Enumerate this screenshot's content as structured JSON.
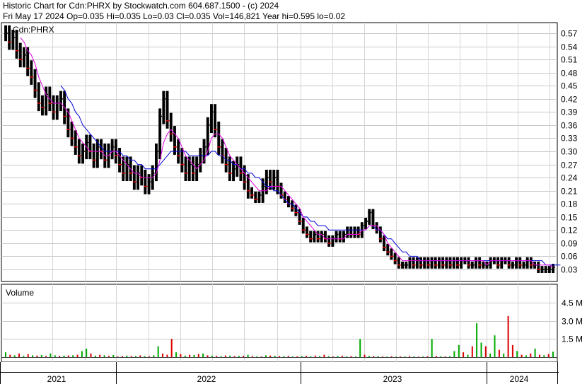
{
  "header": {
    "line1": "Historic Chart for Cdn:PHRX by Stockwatch.com 604.687.1500 - (c) 2024",
    "line2": "Fri May 17 2024   Op=0.035  Hi=0.035   Lo=0.03   Cl=0.035   Vol=146,821   Year hi=0.595   lo=0.02"
  },
  "chart_data": [
    {
      "type": "bar",
      "subtype": "ohlc-price",
      "symbol_label": "Cdn:PHRX",
      "y_axis_side": "right",
      "ylim": [
        0.02,
        0.59
      ],
      "y_ticks": [
        "0.57",
        "0.54",
        "0.51",
        "0.48",
        "0.45",
        "0.42",
        "0.39",
        "0.36",
        "0.33",
        "0.30",
        "0.27",
        "0.24",
        "0.21",
        "0.18",
        "0.15",
        "0.12",
        "0.09",
        "0.06",
        "0.03"
      ],
      "x_ticks": [
        "2021",
        "2022",
        "2023",
        "2024"
      ],
      "grid": true,
      "colors": {
        "bars": "#000000",
        "ma_short": "#e000e0",
        "ma_long": "#0000dd",
        "down_tick": "#dd0000"
      },
      "closes": [
        0.57,
        0.55,
        0.56,
        0.53,
        0.51,
        0.52,
        0.49,
        0.47,
        0.44,
        0.41,
        0.4,
        0.43,
        0.41,
        0.39,
        0.41,
        0.42,
        0.38,
        0.35,
        0.33,
        0.31,
        0.29,
        0.3,
        0.32,
        0.3,
        0.28,
        0.31,
        0.3,
        0.28,
        0.3,
        0.31,
        0.29,
        0.27,
        0.25,
        0.27,
        0.25,
        0.23,
        0.25,
        0.24,
        0.22,
        0.23,
        0.25,
        0.3,
        0.38,
        0.42,
        0.37,
        0.34,
        0.31,
        0.29,
        0.27,
        0.25,
        0.27,
        0.25,
        0.27,
        0.29,
        0.31,
        0.36,
        0.39,
        0.35,
        0.31,
        0.29,
        0.27,
        0.25,
        0.26,
        0.27,
        0.25,
        0.23,
        0.21,
        0.2,
        0.19,
        0.2,
        0.22,
        0.24,
        0.23,
        0.24,
        0.22,
        0.2,
        0.19,
        0.18,
        0.17,
        0.16,
        0.14,
        0.12,
        0.11,
        0.1,
        0.11,
        0.1,
        0.11,
        0.1,
        0.09,
        0.1,
        0.11,
        0.1,
        0.11,
        0.12,
        0.11,
        0.12,
        0.11,
        0.13,
        0.14,
        0.16,
        0.13,
        0.12,
        0.1,
        0.08,
        0.07,
        0.06,
        0.05,
        0.04,
        0.04,
        0.04,
        0.05,
        0.04,
        0.05,
        0.04,
        0.05,
        0.04,
        0.05,
        0.04,
        0.05,
        0.04,
        0.05,
        0.04,
        0.05,
        0.04,
        0.05,
        0.05,
        0.04,
        0.04,
        0.05,
        0.04,
        0.04,
        0.04,
        0.05,
        0.05,
        0.04,
        0.05,
        0.05,
        0.04,
        0.04,
        0.05,
        0.04,
        0.04,
        0.05,
        0.04,
        0.04,
        0.03,
        0.03,
        0.03,
        0.03,
        0.035
      ],
      "ma_short": [
        null,
        null,
        null,
        null,
        0.56,
        0.55,
        0.53,
        0.52,
        0.5,
        0.47,
        0.45,
        0.43,
        0.42,
        0.41,
        0.41,
        0.41,
        0.4,
        0.39,
        0.37,
        0.35,
        0.33,
        0.32,
        0.31,
        0.3,
        0.3,
        0.3,
        0.3,
        0.29,
        0.29,
        0.3,
        0.3,
        0.29,
        0.28,
        0.27,
        0.26,
        0.25,
        0.25,
        0.24,
        0.24,
        0.24,
        0.24,
        0.25,
        0.28,
        0.32,
        0.34,
        0.35,
        0.34,
        0.33,
        0.31,
        0.29,
        0.28,
        0.27,
        0.26,
        0.27,
        0.28,
        0.3,
        0.33,
        0.34,
        0.34,
        0.33,
        0.31,
        0.29,
        0.28,
        0.27,
        0.26,
        0.25,
        0.24,
        0.23,
        0.22,
        0.21,
        0.21,
        0.21,
        0.22,
        0.22,
        0.22,
        0.22,
        0.21,
        0.2,
        0.19,
        0.18,
        0.17,
        0.15,
        0.14,
        0.13,
        0.12,
        0.11,
        0.11,
        0.1,
        0.1,
        0.1,
        0.1,
        0.1,
        0.1,
        0.11,
        0.11,
        0.11,
        0.11,
        0.12,
        0.12,
        0.13,
        0.13,
        0.13,
        0.12,
        0.11,
        0.09,
        0.08,
        0.07,
        0.06,
        0.05,
        0.05,
        0.05,
        0.05,
        0.05,
        0.05,
        0.05,
        0.05,
        0.05,
        0.05,
        0.05,
        0.05,
        0.05,
        0.05,
        0.05,
        0.05,
        0.05,
        0.05,
        0.05,
        0.05,
        0.05,
        0.05,
        0.05,
        0.04,
        0.05,
        0.05,
        0.05,
        0.05,
        0.05,
        0.05,
        0.05,
        0.05,
        0.05,
        0.05,
        0.05,
        0.05,
        0.04,
        0.04,
        0.04,
        0.04,
        0.04,
        0.035
      ],
      "ma_long": [
        null,
        null,
        null,
        null,
        null,
        null,
        null,
        null,
        null,
        null,
        null,
        null,
        null,
        null,
        null,
        0.45,
        0.44,
        0.42,
        0.41,
        0.39,
        0.38,
        0.36,
        0.35,
        0.34,
        0.33,
        0.32,
        0.31,
        0.3,
        0.3,
        0.3,
        0.3,
        0.3,
        0.29,
        0.29,
        0.28,
        0.28,
        0.27,
        0.27,
        0.26,
        0.26,
        0.26,
        0.26,
        0.27,
        0.28,
        0.29,
        0.3,
        0.3,
        0.3,
        0.3,
        0.3,
        0.29,
        0.29,
        0.29,
        0.29,
        0.29,
        0.29,
        0.3,
        0.3,
        0.29,
        0.29,
        0.28,
        0.28,
        0.27,
        0.27,
        0.26,
        0.26,
        0.25,
        0.25,
        0.24,
        0.24,
        0.23,
        0.22,
        0.22,
        0.21,
        0.21,
        0.2,
        0.19,
        0.18,
        0.18,
        0.17,
        0.16,
        0.15,
        0.15,
        0.14,
        0.14,
        0.13,
        0.13,
        0.13,
        0.12,
        0.12,
        0.12,
        0.12,
        0.12,
        0.12,
        0.12,
        0.12,
        0.12,
        0.12,
        0.12,
        0.13,
        0.13,
        0.12,
        0.12,
        0.11,
        0.1,
        0.1,
        0.09,
        0.08,
        0.07,
        0.07,
        0.06,
        0.06,
        0.06,
        0.05,
        0.05,
        0.05,
        0.05,
        0.05,
        0.05,
        0.05,
        0.05,
        0.05,
        0.05,
        0.05,
        0.05,
        0.05,
        0.05,
        0.05,
        0.05,
        0.05,
        0.05,
        0.05,
        0.05,
        0.05,
        0.05,
        0.05,
        0.05,
        0.05,
        0.05,
        0.05,
        0.05,
        0.05,
        0.05,
        0.05,
        0.05,
        0.05,
        0.05,
        0.04,
        0.04,
        0.04,
        0.04,
        0.04
      ]
    },
    {
      "type": "bar",
      "subtype": "volume",
      "title": "Volume",
      "y_axis_side": "right",
      "ylim": [
        0,
        5000000
      ],
      "y_ticks": [
        "4.5 M",
        "3.0 M",
        "1.5 M"
      ],
      "colors": {
        "up": "#00aa00",
        "down": "#dd0000",
        "neutral": "#000000"
      },
      "values": [
        400000,
        200000,
        150000,
        300000,
        100000,
        250000,
        150000,
        120000,
        180000,
        90000,
        300000,
        150000,
        100000,
        120000,
        140000,
        160000,
        200000,
        500000,
        700000,
        300000,
        120000,
        200000,
        150000,
        100000,
        180000,
        60000,
        80000,
        120000,
        90000,
        100000,
        140000,
        80000,
        70000,
        150000,
        900000,
        300000,
        200000,
        1500000,
        400000,
        250000,
        120000,
        200000,
        180000,
        260000,
        300000,
        150000,
        120000,
        100000,
        80000,
        140000,
        120000,
        90000,
        100000,
        110000,
        200000,
        80000,
        70000,
        60000,
        150000,
        130000,
        110000,
        90000,
        80000,
        100000,
        60000,
        70000,
        90000,
        110000,
        60000,
        120000,
        80000,
        200000,
        80000,
        60000,
        90000,
        110000,
        70000,
        90000,
        60000,
        1500000,
        200000,
        100000,
        80000,
        90000,
        60000,
        50000,
        70000,
        40000,
        60000,
        50000,
        80000,
        60000,
        40000,
        50000,
        70000,
        1500000,
        100000,
        70000,
        60000,
        80000,
        500000,
        1000000,
        400000,
        200000,
        900000,
        2800000,
        1200000,
        900000,
        300000,
        1800000,
        600000,
        300000,
        3400000,
        1000000,
        500000,
        200000,
        150000,
        300000,
        700000,
        200000,
        150000,
        250000,
        450000
      ],
      "dirs": [
        "u",
        "d",
        "u",
        "d",
        "u",
        "d",
        "u",
        "d",
        "u",
        "d",
        "u",
        "u",
        "d",
        "u",
        "d",
        "u",
        "d",
        "u",
        "u",
        "d",
        "u",
        "d",
        "u",
        "d",
        "u",
        "d",
        "d",
        "u",
        "d",
        "u",
        "d",
        "u",
        "d",
        "u",
        "u",
        "d",
        "d",
        "d",
        "u",
        "d",
        "u",
        "d",
        "u",
        "d",
        "u",
        "d",
        "u",
        "d",
        "u",
        "d",
        "u",
        "d",
        "u",
        "d",
        "u",
        "d",
        "u",
        "d",
        "u",
        "d",
        "u",
        "d",
        "u",
        "d",
        "u",
        "d",
        "u",
        "d",
        "u",
        "d",
        "u",
        "d",
        "u",
        "d",
        "u",
        "d",
        "u",
        "d",
        "u",
        "u",
        "d",
        "u",
        "d",
        "u",
        "d",
        "u",
        "d",
        "u",
        "d",
        "u",
        "d",
        "u",
        "d",
        "u",
        "d",
        "u",
        "d",
        "u",
        "d",
        "u",
        "u",
        "u",
        "d",
        "u",
        "d",
        "u",
        "u",
        "d",
        "u",
        "u",
        "d",
        "u",
        "d",
        "d",
        "u",
        "d",
        "u",
        "d",
        "u",
        "d",
        "u",
        "d",
        "u"
      ]
    }
  ]
}
